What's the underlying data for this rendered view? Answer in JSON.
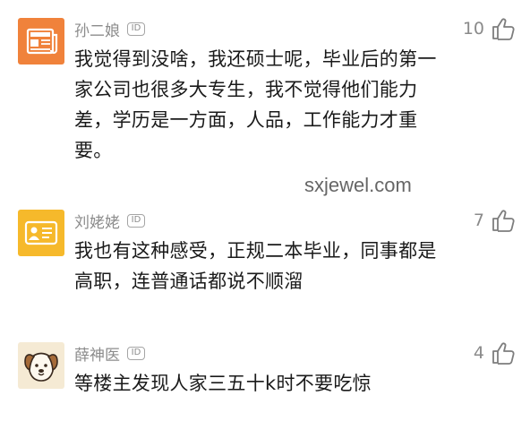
{
  "comments": [
    {
      "username": "孙二娘",
      "id_badge": "ID",
      "avatar_icon": "newspaper-icon",
      "avatar_color": "#f0823b",
      "likes": "10",
      "lines": [
        "我觉得到没啥，我还硕士呢，毕业后的第一",
        "家公司也很多大专生，我不觉得他们能力",
        "差，学历是一方面，人品，工作能力才重",
        "要。"
      ]
    },
    {
      "username": "刘姥姥",
      "id_badge": "ID",
      "avatar_icon": "id-card-icon",
      "avatar_color": "#f6b92b",
      "likes": "7",
      "lines": [
        "我也有这种感受，正规二本毕业，同事都是",
        "高职，连普通话都说不顺溜"
      ]
    },
    {
      "username": "薛神医",
      "id_badge": "ID",
      "avatar_icon": "dog-icon",
      "avatar_color": "#f5ead4",
      "likes": "4",
      "lines": [
        "等楼主发现人家三五十k时不要吃惊"
      ]
    }
  ],
  "watermark": "sxjewel.com",
  "like_icon": "thumbs-up-icon"
}
